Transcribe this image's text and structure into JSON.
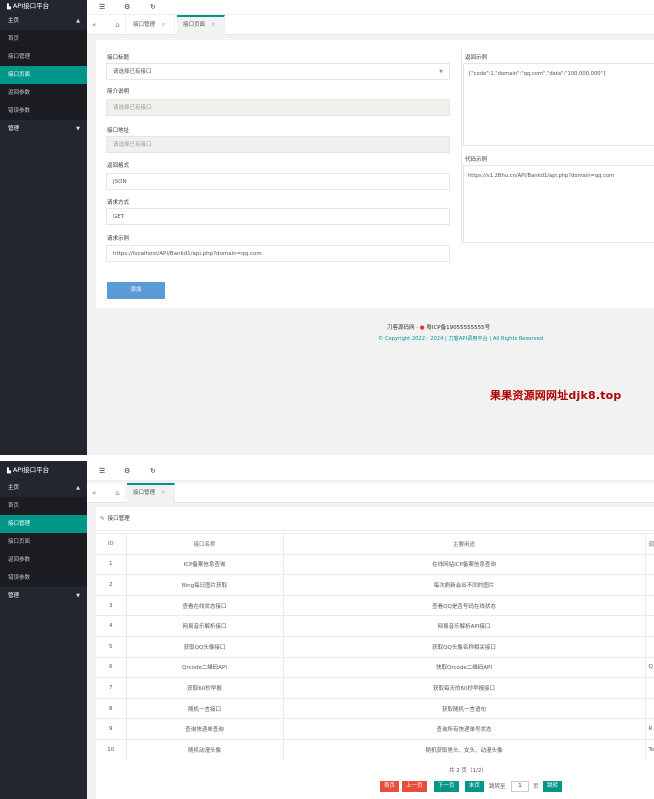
{
  "app": {
    "title": "API接口平台",
    "logo_icon": "▙"
  },
  "sidebar": {
    "group_main": "主页",
    "group_manage": "管理",
    "items": [
      "首页",
      "接口管理",
      "接口页面",
      "返回参数",
      "错误参数"
    ]
  },
  "icons": {
    "menu": "☰",
    "settings": "⚙",
    "refresh": "↻",
    "collapse": "«",
    "home": "⌂",
    "close": "×",
    "arrow_up": "▲",
    "arrow_down": "▼",
    "pen": "✎",
    "police": "●"
  },
  "shot1": {
    "tabs": [
      "接口管理",
      "接口页面"
    ],
    "form": {
      "api_title_label": "接口标题",
      "api_title_value": "请选择已有接口",
      "intro_label": "简介说明",
      "intro_value": "请选择已有接口",
      "url_label": "接口地址",
      "url_value": "请选择已有接口",
      "format_label": "返回格式",
      "format_value": "JSON",
      "method_label": "请求方式",
      "method_value": "GET",
      "example_label": "请求示例",
      "example_value": "https://localhost/API/Bankd1/api.php?domain=qq.com",
      "return_label": "返回示例",
      "return_value": "{\"code\":1,\"domain\":\"qq.com\",\"data\":\"100,000,000\"}",
      "code_label": "代码示例",
      "code_value": "https://v1.2Bhu.cn/API/Bankd1/api.php?domain=qq.com",
      "add_button": "添加"
    },
    "footer": {
      "line1": "刀客源码网",
      "icp": "粤ICP备19055555555号",
      "copyright": "© Copyright 2022 - 2024 | 刀客API调用平台 | All Rights Reserved"
    },
    "watermark": "果果资源网网址djk8.top"
  },
  "shot2": {
    "tabs": [
      "接口管理"
    ],
    "card_title": "接口管理",
    "columns": [
      "ID",
      "接口名称",
      "主要用途",
      "调"
    ],
    "rows": [
      [
        "1",
        "ICP备案信息查询",
        "在线网站ICP备案信息查询",
        ""
      ],
      [
        "2",
        "Bing每日图片获取",
        "每次刷新会出不同的图片",
        ""
      ],
      [
        "3",
        "查看在线状态接口",
        "查看QQ是否号码在线状态",
        ""
      ],
      [
        "4",
        "网易音乐解析接口",
        "网易音乐解析API接口",
        ""
      ],
      [
        "5",
        "获取QQ头像接口",
        "获取QQ头像名称相关接口",
        ""
      ],
      [
        "6",
        "Qrcode二维码API",
        "快取Qrcode二维码API",
        "Q"
      ],
      [
        "7",
        "获取60秒早报",
        "获取每天的60秒早报接口",
        ""
      ],
      [
        "8",
        "随机一言接口",
        "获取随机一言语句",
        ""
      ],
      [
        "9",
        "查询快递单查询",
        "查询所有快递单号状态",
        "R"
      ],
      [
        "10",
        "随机动漫头像",
        "随机获取男头、女头、动漫头像",
        "To"
      ]
    ],
    "pagination": {
      "info": "共 2 页（1/2）",
      "first": "首页",
      "prev": "上一页",
      "next": "下一页",
      "last": "末页",
      "jump_label": "跳转至",
      "page_value": "1",
      "page_unit": "页",
      "jump_button": "跳转"
    }
  }
}
